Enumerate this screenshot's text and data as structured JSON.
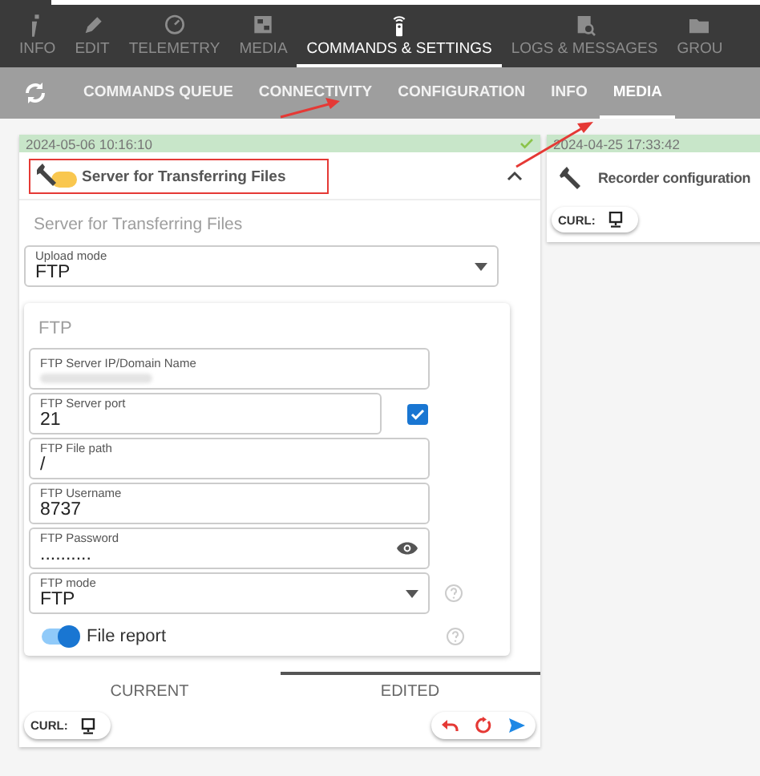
{
  "nav_tabs": [
    {
      "label": "INFO",
      "selected": false
    },
    {
      "label": "EDIT",
      "selected": false
    },
    {
      "label": "TELEMETRY",
      "selected": false
    },
    {
      "label": "MEDIA",
      "selected": false
    },
    {
      "label": "COMMANDS & SETTINGS",
      "selected": true
    },
    {
      "label": "LOGS & MESSAGES",
      "selected": false
    },
    {
      "label": "GROU",
      "selected": false
    }
  ],
  "sub_tabs": [
    {
      "label": "COMMANDS QUEUE",
      "selected": false
    },
    {
      "label": "CONNECTIVITY",
      "selected": false
    },
    {
      "label": "CONFIGURATION",
      "selected": false
    },
    {
      "label": "INFO",
      "selected": false
    },
    {
      "label": "MEDIA",
      "selected": true
    }
  ],
  "main_card": {
    "timestamp": "2024-05-06 10:16:10",
    "title": "Server for Transferring Files",
    "expanded": true,
    "subtitle": "Server for Transferring Files",
    "upload_mode": {
      "label": "Upload mode",
      "value": "FTP"
    },
    "ftp_panel": {
      "title": "FTP",
      "fields": [
        {
          "kind": "text",
          "label": "FTP Server IP/Domain Name",
          "redacted": true
        },
        {
          "kind": "text",
          "label": "FTP Server port",
          "value": "21",
          "checkbox": {
            "checked": true
          }
        },
        {
          "kind": "text",
          "label": "FTP File path",
          "value": "/"
        },
        {
          "kind": "text",
          "label": "FTP Username",
          "value": "8737"
        },
        {
          "kind": "password",
          "label": "FTP Password",
          "value": ".........."
        },
        {
          "kind": "select",
          "label": "FTP mode",
          "value": "FTP",
          "help": true
        },
        {
          "kind": "toggle",
          "label": "File report",
          "on": true,
          "help": true
        }
      ]
    },
    "view_tabs": [
      {
        "label": "CURRENT",
        "selected": false
      },
      {
        "label": "EDITED",
        "selected": true
      }
    ],
    "curl_label": "CURL:"
  },
  "side_card": {
    "timestamp": "2024-04-25 17:33:42",
    "title": "Recorder configuration",
    "curl_label": "CURL:"
  }
}
